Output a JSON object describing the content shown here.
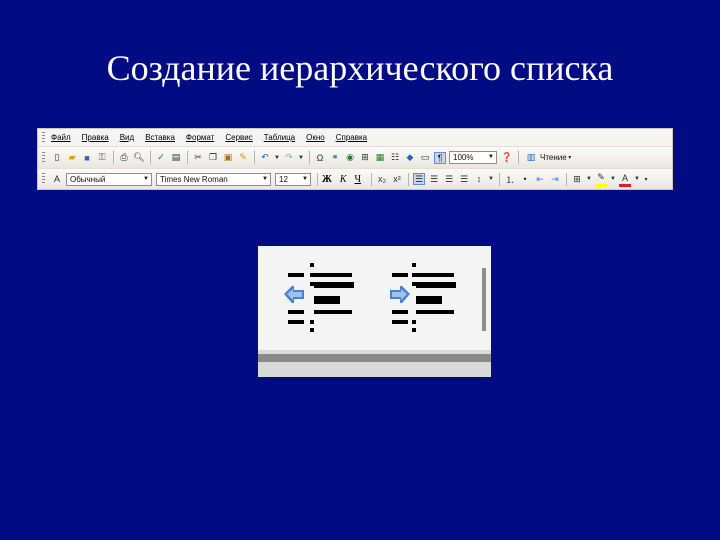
{
  "slide": {
    "title": "Создание иерархического списка"
  },
  "menubar": {
    "items": [
      "Файл",
      "Правка",
      "Вид",
      "Вставка",
      "Формат",
      "Сервис",
      "Таблица",
      "Окно",
      "Справка"
    ]
  },
  "standard_toolbar": {
    "zoom_value": "100%",
    "read_label": "Чтение"
  },
  "formatting_toolbar": {
    "style_value": "Обычный",
    "font_value": "Times New Roman",
    "size_value": "12",
    "bold_glyph": "Ж",
    "italic_glyph": "К",
    "underline_glyph": "Ч"
  },
  "colors": {
    "slide_background": "#000b84",
    "title_text": "#ffffff",
    "toolbar_background": "#f3f2ee",
    "indent_arrow": "#4a80cc"
  },
  "zoomed_buttons": {
    "left": "decrease-indent",
    "right": "increase-indent"
  }
}
